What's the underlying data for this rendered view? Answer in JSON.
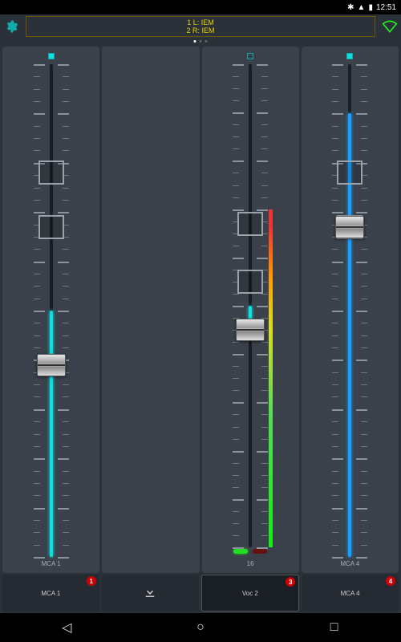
{
  "status": {
    "time": "12:51",
    "bt": "✱",
    "batt": "▮"
  },
  "header": {
    "line1": "1  L:  IEM",
    "line2": "2  R:  IEM",
    "page_dots": 3,
    "active_dot": 0
  },
  "accent_color": "#1dd",
  "channels": [
    {
      "label": "MCA 1",
      "mute_on": true,
      "fader_pos": 0.61,
      "fill_color": "#1dd",
      "fill_from": 0.5,
      "fill_to": 1.0,
      "boxes": [
        0.22,
        0.33
      ],
      "meter": null,
      "indicators": null
    },
    {
      "label": "",
      "mute_on": false,
      "empty": true,
      "indicators": null
    },
    {
      "label": "16",
      "mute_on": false,
      "fader_pos": 0.55,
      "fill_color": "#1dd",
      "fill_from": 0.5,
      "fill_to": 0.55,
      "boxes": [
        0.33,
        0.45
      ],
      "meter": {
        "top": 0.3,
        "bottom": 1.0
      },
      "indicators": [
        "g",
        "r"
      ]
    },
    {
      "label": "MCA 4",
      "mute_on": true,
      "fader_pos": 0.33,
      "fill_color": "#18a0ff",
      "fill_from": 0.1,
      "fill_to": 1.0,
      "boxes": [
        0.22,
        0.33
      ],
      "meter": null,
      "indicators": null
    }
  ],
  "bottom": {
    "cells": [
      {
        "label": "MCA 1",
        "badge": "1",
        "icon": null
      },
      {
        "label": "",
        "badge": null,
        "icon": "download"
      },
      {
        "label": "Voc 2",
        "badge": "3",
        "icon": null,
        "active": true
      },
      {
        "label": "MCA 4",
        "badge": "4",
        "icon": null
      }
    ]
  },
  "nav": {
    "back": "◁",
    "home": "○",
    "recent": "□"
  }
}
